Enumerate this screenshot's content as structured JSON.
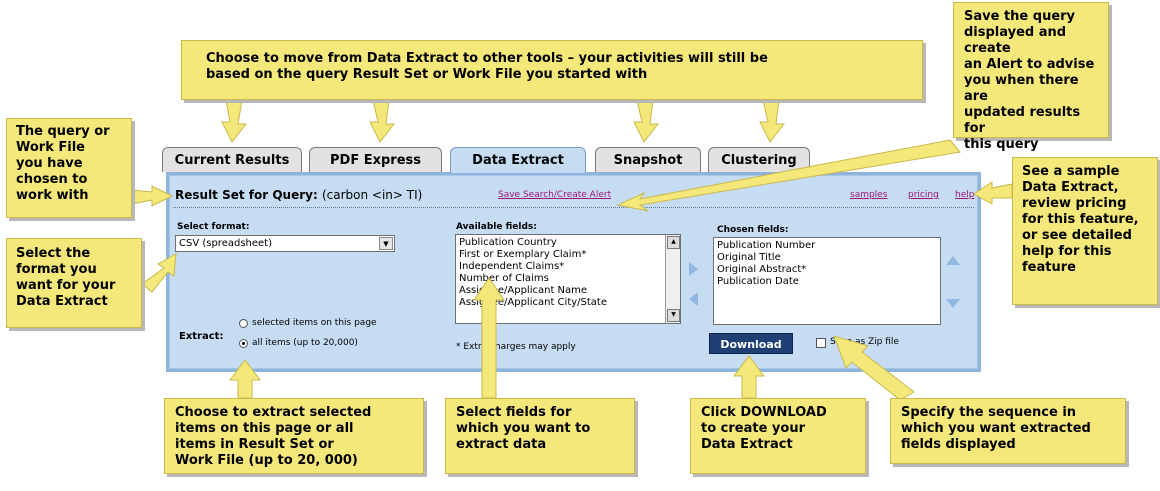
{
  "tabs": [
    {
      "label": "Current Results",
      "active": false
    },
    {
      "label": "PDF Express",
      "active": false
    },
    {
      "label": "Data Extract",
      "active": true
    },
    {
      "label": "Snapshot",
      "active": false
    },
    {
      "label": "Clustering",
      "active": false
    }
  ],
  "query_bar": {
    "label": "Result Set for Query:",
    "value": "(carbon <in> TI)",
    "save_link": "Save Search/Create Alert",
    "links": [
      "samples",
      "pricing",
      "help"
    ]
  },
  "format": {
    "label": "Select format:",
    "selected": "CSV (spreadsheet)"
  },
  "available_fields": {
    "label": "Available fields:",
    "items": [
      "Publication Country",
      "First or Exemplary Claim*",
      "Independent Claims*",
      "Number of Claims",
      "Assignee/Applicant Name",
      "Assignee/Applicant City/State"
    ]
  },
  "chosen_fields": {
    "label": "Chosen fields:",
    "items": [
      "Publication Number",
      "Original Title",
      "Original Abstract*",
      "Publication Date"
    ]
  },
  "extract": {
    "label": "Extract:",
    "options": [
      {
        "label": "selected items on this page",
        "checked": false
      },
      {
        "label": "all items (up to 20,000)",
        "checked": true
      }
    ]
  },
  "note": "* Extra charges may apply",
  "download_label": "Download",
  "zip_label": "Save as Zip file",
  "callouts": {
    "top_tools": [
      "Choose to move from Data Extract to other tools – your activities will still be",
      "based on the query Result Set or Work File you started with"
    ],
    "save_query": [
      "Save the query",
      "displayed and create",
      "an Alert to advise",
      "you when there are",
      "updated results for",
      "this query"
    ],
    "query_file": [
      "The query or",
      "Work File",
      "you have",
      "chosen to",
      "work with"
    ],
    "sample": [
      "See a sample",
      "Data Extract,",
      "review pricing",
      "for this feature,",
      "or see detailed",
      "help for this",
      "feature"
    ],
    "select_format": [
      "Select the",
      "format you",
      "want for your",
      "Data Extract"
    ],
    "extract_items": [
      "Choose to extract selected",
      "items on this page or all",
      "items in Result Set or",
      "Work File (up to 20, 000)"
    ],
    "select_fields": [
      "Select fields for",
      "which you want to",
      "extract data"
    ],
    "download": [
      "Click DOWNLOAD",
      "to create your",
      "Data Extract"
    ],
    "sequence": [
      "Specify the sequence in",
      "which you want extracted",
      "fields displayed"
    ]
  },
  "colors": {
    "callout": "#f4e87a",
    "panel": "#c6dcf3",
    "active_tab": "#c6dcf3",
    "download_button": "#1f3f75",
    "link": "#a0187a"
  }
}
